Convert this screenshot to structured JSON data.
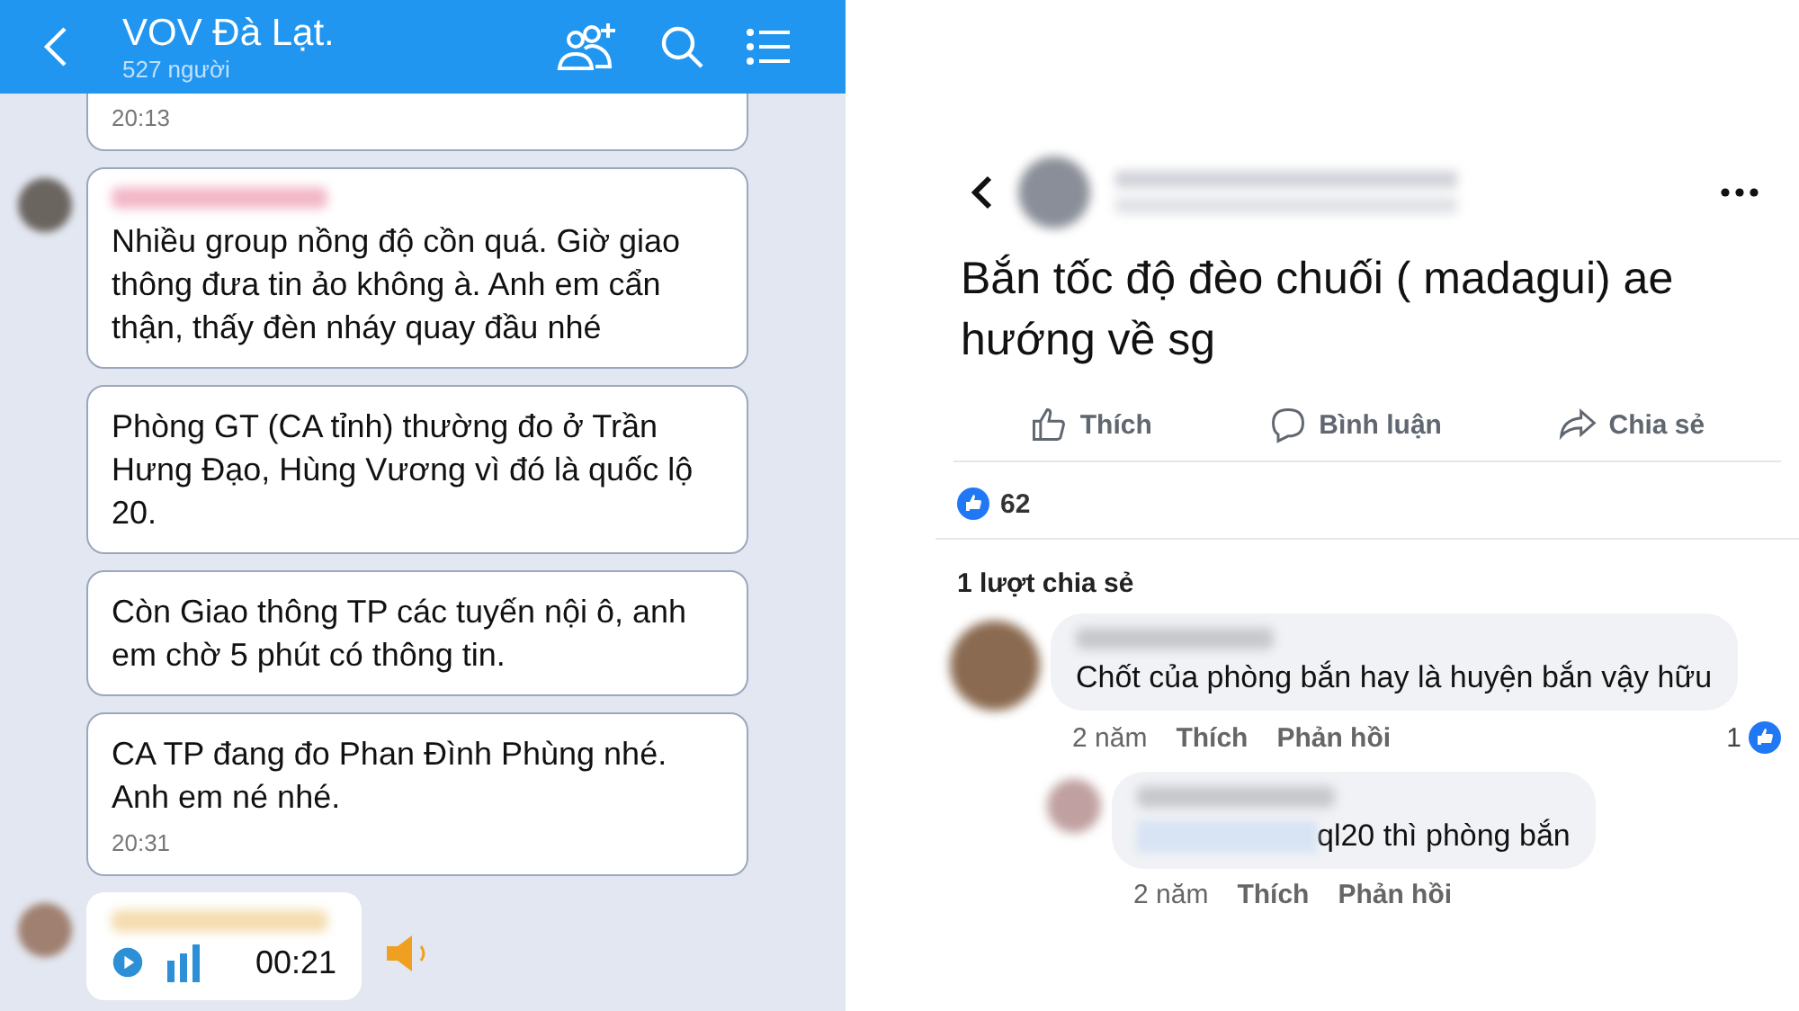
{
  "chat": {
    "title": "VOV Đà Lạt.",
    "subtitle": "527 người",
    "messages": [
      {
        "kind": "time_only",
        "show_avatar": false,
        "time": "20:13"
      },
      {
        "kind": "text",
        "show_avatar": true,
        "text": "Nhiều group nồng độ cồn quá. Giờ giao thông đưa tin ảo không à. Anh em cẩn thận, thấy đèn nháy quay đầu nhé"
      },
      {
        "kind": "text",
        "show_avatar": false,
        "text": "Phòng GT (CA tỉnh) thường đo ở Trần Hưng Đạo, Hùng Vương vì đó là quốc lộ 20."
      },
      {
        "kind": "text",
        "show_avatar": false,
        "text": "Còn Giao thông TP các tuyến nội ô, anh em chờ 5 phút có thông tin."
      },
      {
        "kind": "text",
        "show_avatar": false,
        "text": "CA TP đang đo Phan Đình Phùng nhé. Anh em né nhé.",
        "time": "20:31"
      },
      {
        "kind": "voice",
        "show_avatar": true,
        "duration": "00:21"
      }
    ]
  },
  "post": {
    "text": "Bắn tốc độ đèo chuối ( madagui) ae hướng về sg",
    "actions": [
      {
        "kind": "like",
        "label": "Thích"
      },
      {
        "kind": "comment",
        "label": "Bình luận"
      },
      {
        "kind": "share",
        "label": "Chia sẻ"
      }
    ],
    "like_count": "62",
    "shares": "1 lượt chia sẻ",
    "comments": [
      {
        "text": "Chốt của phòng bắn hay là huyện bắn vậy hữu",
        "time": "2 năm",
        "like": "Thích",
        "reply": "Phản hồi",
        "reaction_count": "1",
        "nested": false
      },
      {
        "text": "ql20 thì phòng bắn",
        "time": "2 năm",
        "like": "Thích",
        "reply": "Phản hồi",
        "nested": true
      }
    ]
  }
}
